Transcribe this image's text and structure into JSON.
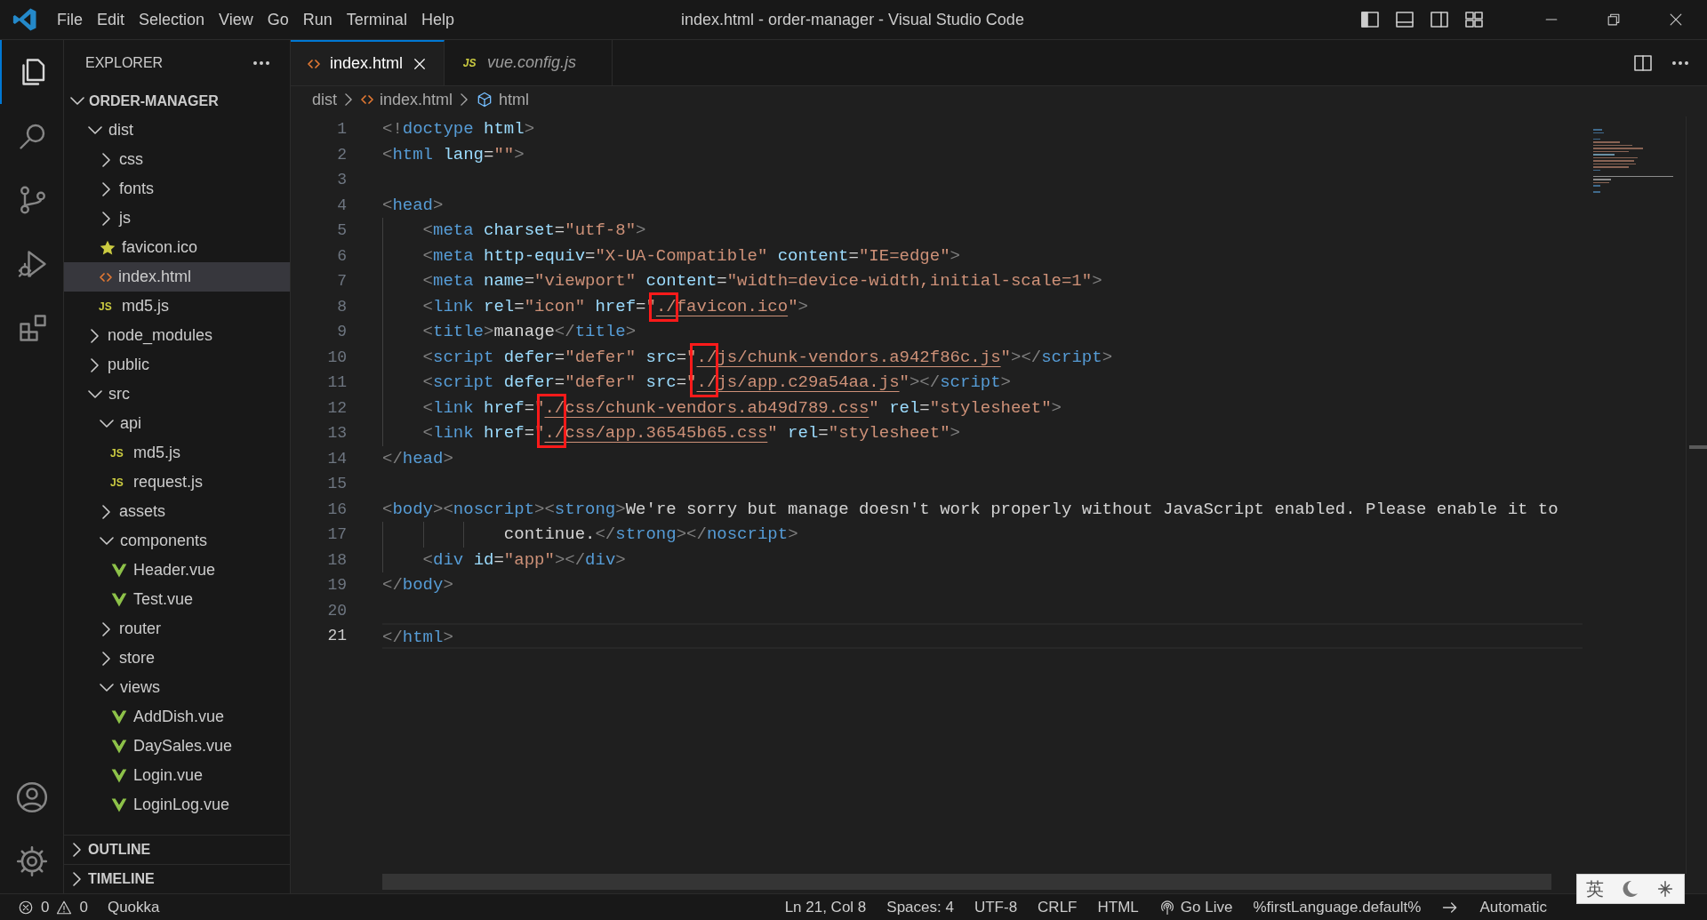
{
  "window": {
    "title": "index.html - order-manager - Visual Studio Code"
  },
  "menu": [
    "File",
    "Edit",
    "Selection",
    "View",
    "Go",
    "Run",
    "Terminal",
    "Help"
  ],
  "activity_bar": [
    {
      "kind": "files",
      "selected": true
    },
    {
      "kind": "search",
      "selected": false
    },
    {
      "kind": "source-control",
      "selected": false
    },
    {
      "kind": "run",
      "selected": false
    },
    {
      "kind": "extensions",
      "selected": false
    }
  ],
  "sidebar": {
    "title": "EXPLORER",
    "root": "ORDER-MANAGER",
    "tree": [
      {
        "label": "dist",
        "kind": "folder",
        "expanded": true,
        "children": [
          {
            "label": "css",
            "kind": "folder",
            "expanded": false
          },
          {
            "label": "fonts",
            "kind": "folder",
            "expanded": false
          },
          {
            "label": "js",
            "kind": "folder",
            "expanded": false
          },
          {
            "label": "favicon.ico",
            "kind": "star",
            "selected": false
          },
          {
            "label": "index.html",
            "kind": "html",
            "selected": true
          },
          {
            "label": "md5.js",
            "kind": "js",
            "badge": "JS",
            "selected": false
          }
        ]
      },
      {
        "label": "node_modules",
        "kind": "folder",
        "expanded": false
      },
      {
        "label": "public",
        "kind": "folder",
        "expanded": false
      },
      {
        "label": "src",
        "kind": "folder",
        "expanded": true,
        "children": [
          {
            "label": "api",
            "kind": "folder",
            "expanded": true,
            "children": [
              {
                "label": "md5.js",
                "kind": "js",
                "badge": "JS",
                "selected": false
              },
              {
                "label": "request.js",
                "kind": "js",
                "badge": "JS",
                "selected": false
              }
            ]
          },
          {
            "label": "assets",
            "kind": "folder",
            "expanded": false
          },
          {
            "label": "components",
            "kind": "folder",
            "expanded": true,
            "children": [
              {
                "label": "Header.vue",
                "kind": "vue",
                "selected": false
              },
              {
                "label": "Test.vue",
                "kind": "vue",
                "selected": false
              }
            ]
          },
          {
            "label": "router",
            "kind": "folder",
            "expanded": false
          },
          {
            "label": "store",
            "kind": "folder",
            "expanded": false
          },
          {
            "label": "views",
            "kind": "folder",
            "expanded": true,
            "children": [
              {
                "label": "AddDish.vue",
                "kind": "vue",
                "selected": false
              },
              {
                "label": "DaySales.vue",
                "kind": "vue",
                "selected": false
              },
              {
                "label": "Login.vue",
                "kind": "vue",
                "selected": false
              },
              {
                "label": "LoginLog.vue",
                "kind": "vue",
                "selected": false
              }
            ]
          }
        ]
      }
    ],
    "sections": [
      "OUTLINE",
      "TIMELINE"
    ]
  },
  "tabs": [
    {
      "label": "index.html",
      "kind": "html",
      "selected": true
    },
    {
      "label": "vue.config.js",
      "kind": "js",
      "badge": "JS",
      "selected": false
    }
  ],
  "breadcrumbs": [
    {
      "label": "dist",
      "kind": "folder"
    },
    {
      "label": "index.html",
      "kind": "html"
    },
    {
      "label": "html",
      "kind": "element"
    }
  ],
  "code": [
    {
      "number": "1",
      "current": false,
      "tokens": [
        {
          "kind": "tag",
          "text": "<!"
        },
        {
          "kind": "name",
          "text": "doctype"
        },
        {
          "kind": "attr",
          "text": " html"
        },
        {
          "kind": "tag",
          "text": ">"
        }
      ]
    },
    {
      "number": "2",
      "current": false,
      "tokens": [
        {
          "kind": "tag",
          "text": "<"
        },
        {
          "kind": "name",
          "text": "html"
        },
        {
          "kind": "attr",
          "text": " lang"
        },
        {
          "kind": "text",
          "text": "="
        },
        {
          "kind": "str",
          "text": "\"\""
        },
        {
          "kind": "tag",
          "text": ">"
        }
      ]
    },
    {
      "number": "3",
      "current": false
    },
    {
      "number": "4",
      "current": false,
      "tokens": [
        {
          "kind": "tag",
          "text": "<"
        },
        {
          "kind": "name",
          "text": "head"
        },
        {
          "kind": "tag",
          "text": ">"
        }
      ]
    },
    {
      "number": "5",
      "current": false,
      "tokens": [
        {
          "kind": "tag",
          "text": "    <"
        },
        {
          "kind": "name",
          "text": "meta"
        },
        {
          "kind": "attr",
          "text": " charset"
        },
        {
          "kind": "text",
          "text": "="
        },
        {
          "kind": "str",
          "text": "\"utf-8\""
        },
        {
          "kind": "tag",
          "text": ">"
        }
      ]
    },
    {
      "number": "6",
      "current": false,
      "tokens": [
        {
          "kind": "tag",
          "text": "    <"
        },
        {
          "kind": "name",
          "text": "meta"
        },
        {
          "kind": "attr",
          "text": " http-equiv"
        },
        {
          "kind": "text",
          "text": "="
        },
        {
          "kind": "str",
          "text": "\"X-UA-Compatible\""
        },
        {
          "kind": "attr",
          "text": " content"
        },
        {
          "kind": "text",
          "text": "="
        },
        {
          "kind": "str",
          "text": "\"IE=edge\""
        },
        {
          "kind": "tag",
          "text": ">"
        }
      ]
    },
    {
      "number": "7",
      "current": false,
      "tokens": [
        {
          "kind": "tag",
          "text": "    <"
        },
        {
          "kind": "name",
          "text": "meta"
        },
        {
          "kind": "attr",
          "text": " name"
        },
        {
          "kind": "text",
          "text": "="
        },
        {
          "kind": "str",
          "text": "\"viewport\""
        },
        {
          "kind": "attr",
          "text": " content"
        },
        {
          "kind": "text",
          "text": "="
        },
        {
          "kind": "str",
          "text": "\"width=device-width,initial-scale=1\""
        },
        {
          "kind": "tag",
          "text": ">"
        }
      ]
    },
    {
      "number": "8",
      "current": false,
      "tokens": [
        {
          "kind": "tag",
          "text": "    <"
        },
        {
          "kind": "name",
          "text": "link"
        },
        {
          "kind": "attr",
          "text": " rel"
        },
        {
          "kind": "text",
          "text": "="
        },
        {
          "kind": "str",
          "text": "\"icon\""
        },
        {
          "kind": "attr",
          "text": " href"
        },
        {
          "kind": "text",
          "text": "="
        },
        {
          "kind": "str",
          "text": "\""
        },
        {
          "kind": "link",
          "text": "./",
          "box_top": true,
          "box_bottom": true
        },
        {
          "kind": "link",
          "text": "favicon.ico"
        },
        {
          "kind": "str",
          "text": "\""
        },
        {
          "kind": "tag",
          "text": ">"
        }
      ]
    },
    {
      "number": "9",
      "current": false,
      "tokens": [
        {
          "kind": "tag",
          "text": "    <"
        },
        {
          "kind": "name",
          "text": "title"
        },
        {
          "kind": "tag",
          "text": ">"
        },
        {
          "kind": "text",
          "text": "manage"
        },
        {
          "kind": "tag",
          "text": "</"
        },
        {
          "kind": "name",
          "text": "title"
        },
        {
          "kind": "tag",
          "text": ">"
        }
      ]
    },
    {
      "number": "10",
      "current": false,
      "tokens": [
        {
          "kind": "tag",
          "text": "    <"
        },
        {
          "kind": "name",
          "text": "script"
        },
        {
          "kind": "attr",
          "text": " defer"
        },
        {
          "kind": "text",
          "text": "="
        },
        {
          "kind": "str",
          "text": "\"defer\""
        },
        {
          "kind": "attr",
          "text": " src"
        },
        {
          "kind": "text",
          "text": "="
        },
        {
          "kind": "str",
          "text": "\""
        },
        {
          "kind": "link",
          "text": "./",
          "box_top": true,
          "box_bottom": false
        },
        {
          "kind": "link",
          "text": "js/chunk-vendors.a942f86c.js"
        },
        {
          "kind": "str",
          "text": "\""
        },
        {
          "kind": "tag",
          "text": "></"
        },
        {
          "kind": "name",
          "text": "script"
        },
        {
          "kind": "tag",
          "text": ">"
        }
      ]
    },
    {
      "number": "11",
      "current": false,
      "tokens": [
        {
          "kind": "tag",
          "text": "    <"
        },
        {
          "kind": "name",
          "text": "script"
        },
        {
          "kind": "attr",
          "text": " defer"
        },
        {
          "kind": "text",
          "text": "="
        },
        {
          "kind": "str",
          "text": "\"defer\""
        },
        {
          "kind": "attr",
          "text": " src"
        },
        {
          "kind": "text",
          "text": "="
        },
        {
          "kind": "str",
          "text": "\""
        },
        {
          "kind": "link",
          "text": "./",
          "box_top": false,
          "box_bottom": true
        },
        {
          "kind": "link",
          "text": "js/app.c29a54aa.js"
        },
        {
          "kind": "str",
          "text": "\""
        },
        {
          "kind": "tag",
          "text": "></"
        },
        {
          "kind": "name",
          "text": "script"
        },
        {
          "kind": "tag",
          "text": ">"
        }
      ]
    },
    {
      "number": "12",
      "current": false,
      "tokens": [
        {
          "kind": "tag",
          "text": "    <"
        },
        {
          "kind": "name",
          "text": "link"
        },
        {
          "kind": "attr",
          "text": " href"
        },
        {
          "kind": "text",
          "text": "="
        },
        {
          "kind": "str",
          "text": "\""
        },
        {
          "kind": "link",
          "text": "./",
          "box_top": true,
          "box_bottom": false
        },
        {
          "kind": "link",
          "text": "css/chunk-vendors.ab49d789.css"
        },
        {
          "kind": "str",
          "text": "\""
        },
        {
          "kind": "attr",
          "text": " rel"
        },
        {
          "kind": "text",
          "text": "="
        },
        {
          "kind": "str",
          "text": "\"stylesheet\""
        },
        {
          "kind": "tag",
          "text": ">"
        }
      ]
    },
    {
      "number": "13",
      "current": false,
      "tokens": [
        {
          "kind": "tag",
          "text": "    <"
        },
        {
          "kind": "name",
          "text": "link"
        },
        {
          "kind": "attr",
          "text": " href"
        },
        {
          "kind": "text",
          "text": "="
        },
        {
          "kind": "str",
          "text": "\""
        },
        {
          "kind": "link",
          "text": "./",
          "box_top": false,
          "box_bottom": true
        },
        {
          "kind": "link",
          "text": "css/app.36545b65.css"
        },
        {
          "kind": "str",
          "text": "\""
        },
        {
          "kind": "attr",
          "text": " rel"
        },
        {
          "kind": "text",
          "text": "="
        },
        {
          "kind": "str",
          "text": "\"stylesheet\""
        },
        {
          "kind": "tag",
          "text": ">"
        }
      ]
    },
    {
      "number": "14",
      "current": false,
      "tokens": [
        {
          "kind": "tag",
          "text": "</"
        },
        {
          "kind": "name",
          "text": "head"
        },
        {
          "kind": "tag",
          "text": ">"
        }
      ]
    },
    {
      "number": "15",
      "current": false
    },
    {
      "number": "16",
      "current": false,
      "tokens": [
        {
          "kind": "tag",
          "text": "<"
        },
        {
          "kind": "name",
          "text": "body"
        },
        {
          "kind": "tag",
          "text": "><"
        },
        {
          "kind": "name",
          "text": "noscript"
        },
        {
          "kind": "tag",
          "text": "><"
        },
        {
          "kind": "name",
          "text": "strong"
        },
        {
          "kind": "tag",
          "text": ">"
        },
        {
          "kind": "text",
          "text": "We're sorry but manage doesn't work properly without JavaScript enabled. Please enable it to"
        }
      ]
    },
    {
      "number": "17",
      "current": false,
      "tokens": [
        {
          "kind": "text",
          "text": "            continue."
        },
        {
          "kind": "tag",
          "text": "</"
        },
        {
          "kind": "name",
          "text": "strong"
        },
        {
          "kind": "tag",
          "text": "></"
        },
        {
          "kind": "name",
          "text": "noscript"
        },
        {
          "kind": "tag",
          "text": ">"
        }
      ]
    },
    {
      "number": "18",
      "current": false,
      "tokens": [
        {
          "kind": "tag",
          "text": "    <"
        },
        {
          "kind": "name",
          "text": "div"
        },
        {
          "kind": "attr",
          "text": " id"
        },
        {
          "kind": "text",
          "text": "="
        },
        {
          "kind": "str",
          "text": "\"app\""
        },
        {
          "kind": "tag",
          "text": "></"
        },
        {
          "kind": "name",
          "text": "div"
        },
        {
          "kind": "tag",
          "text": ">"
        }
      ]
    },
    {
      "number": "19",
      "current": false,
      "tokens": [
        {
          "kind": "tag",
          "text": "</"
        },
        {
          "kind": "name",
          "text": "body"
        },
        {
          "kind": "tag",
          "text": ">"
        }
      ]
    },
    {
      "number": "20",
      "current": false
    },
    {
      "number": "21",
      "current": true,
      "tokens": [
        {
          "kind": "tag",
          "text": "</"
        },
        {
          "kind": "name",
          "text": "html"
        },
        {
          "kind": "tag",
          "text": ">"
        }
      ]
    }
  ],
  "status_bar": {
    "left": [
      {
        "kind": "errors",
        "label": "0"
      },
      {
        "kind": "warnings",
        "label": "0"
      },
      {
        "kind": "text",
        "label": "Quokka"
      }
    ],
    "right": [
      {
        "kind": "text",
        "label": "Ln 21, Col 8"
      },
      {
        "kind": "text",
        "label": "Spaces: 4"
      },
      {
        "kind": "text",
        "label": "UTF-8"
      },
      {
        "kind": "text",
        "label": "CRLF"
      },
      {
        "kind": "text",
        "label": "HTML"
      },
      {
        "kind": "golive",
        "label": "Go Live"
      },
      {
        "kind": "text",
        "label": "%firstLanguage.default%"
      },
      {
        "kind": "arrow"
      },
      {
        "kind": "text",
        "label": "Automatic"
      }
    ]
  },
  "ime": {
    "label": "英"
  }
}
